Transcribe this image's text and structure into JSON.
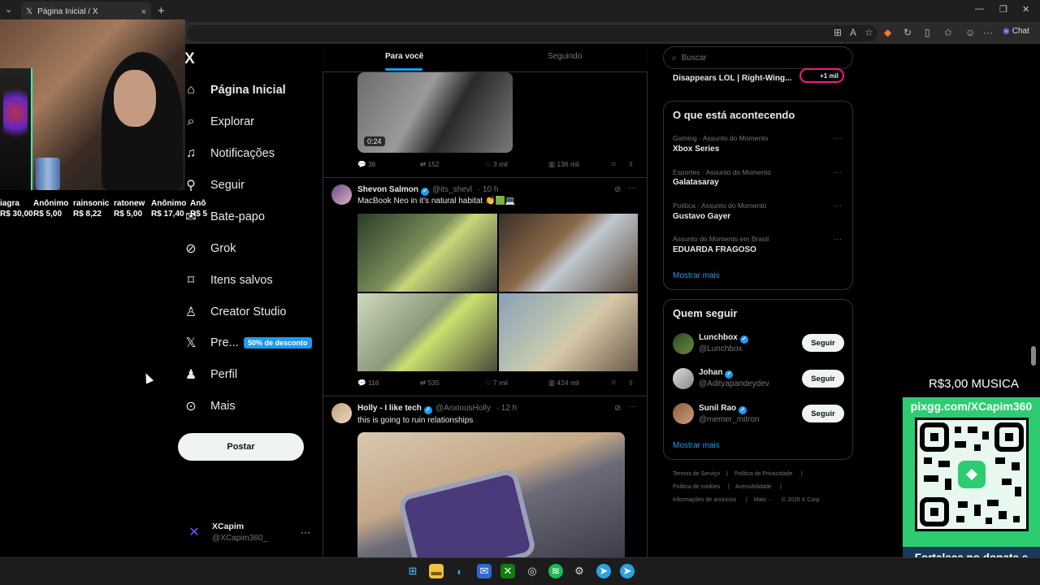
{
  "browser": {
    "tab_title": "Página Inicial / X",
    "tab_close": "×",
    "new_tab": "+",
    "chat_label": "Chat"
  },
  "stream": {
    "donors": [
      {
        "name": "iagra",
        "amount": "R$ 30,00"
      },
      {
        "name": "Anônimo",
        "amount": "R$ 5,00"
      },
      {
        "name": "rainsonic",
        "amount": "R$ 8,22"
      },
      {
        "name": "ratonew",
        "amount": "R$ 5,00"
      },
      {
        "name": "Anônimo",
        "amount": "R$ 17,40"
      },
      {
        "name": "Anô",
        "amount": "R$ 5"
      }
    ],
    "music_price": "R$3,00 MUSICA",
    "qr_url": "pixgg.com/XCapim360",
    "qr_message": "Fortaleça no donate e envie sua mensagem!"
  },
  "sidebar": {
    "logo": "X",
    "items": [
      {
        "label": "Página Inicial",
        "icon": "home-icon"
      },
      {
        "label": "Explorar",
        "icon": "search-icon"
      },
      {
        "label": "Notificações",
        "icon": "bell-icon"
      },
      {
        "label": "Seguir",
        "icon": "add-user-icon"
      },
      {
        "label": "Bate-papo",
        "icon": "chat-icon"
      },
      {
        "label": "Grok",
        "icon": "grok-icon"
      },
      {
        "label": "Itens salvos",
        "icon": "bookmark-icon"
      },
      {
        "label": "Creator Studio",
        "icon": "creator-icon"
      },
      {
        "label": "Pre...",
        "icon": "x-premium-icon"
      },
      {
        "label": "Perfil",
        "icon": "person-icon"
      },
      {
        "label": "Mais",
        "icon": "more-circle-icon"
      }
    ],
    "premium_badge": "50% de desconto",
    "post_button": "Postar",
    "account": {
      "name": "XCapim",
      "handle": "@XCapim360_",
      "more": "···"
    }
  },
  "feed": {
    "tabs": [
      "Para você",
      "Seguindo"
    ],
    "video_post": {
      "duration": "0:24",
      "replies": "36",
      "reposts": "152",
      "likes": "3 mil",
      "views": "136 mil"
    },
    "post2": {
      "author": "Shevon Salmon",
      "handle": "@its_shevl",
      "time": "· 10 h",
      "text": "MacBook Neo in it's natural habitat 👏🟩💻",
      "replies": "116",
      "reposts": "535",
      "likes": "7 mil",
      "views": "424 mil"
    },
    "post3": {
      "author": "Holly - I like tech",
      "handle": "@AnxiousHolly",
      "time": "· 12 h",
      "text": "this is going to ruin relationships"
    }
  },
  "right": {
    "search_placeholder": "Buscar",
    "top_trend": "Disappears LOL | Right-Wing...",
    "live_pill": "+1 mil",
    "trends_title": "O que está acontecendo",
    "trends": [
      {
        "context": "Gaming · Assunto do Momento",
        "name": "Xbox Series"
      },
      {
        "context": "Esportes · Assunto do Momento",
        "name": "Galatasaray"
      },
      {
        "context": "Política · Assunto do Momento",
        "name": "Gustavo Gayer"
      },
      {
        "context": "Assunto do Momento em Brasil",
        "name": "EDUARDA FRAGOSO"
      }
    ],
    "show_more": "Mostrar mais",
    "follow_title": "Quem seguir",
    "follow": [
      {
        "name": "Lunchbox",
        "handle": "@Lunchbox",
        "button": "Seguir"
      },
      {
        "name": "Johan",
        "handle": "@Adityapandeydev",
        "button": "Seguir"
      },
      {
        "name": "Sunil Rao",
        "handle": "@memer_mitron",
        "button": "Seguir"
      }
    ],
    "footer": [
      "Termos de Serviço",
      "|",
      "Política de Privacidade",
      "|",
      "Política de cookies",
      "|",
      "Acessibilidade",
      "|",
      "Informações de anúncios",
      "|",
      "Mais ···",
      "© 2026 X Corp."
    ]
  },
  "colors": {
    "accent": "#1d9bf0",
    "qr_green": "#2ecc71",
    "live": "#f91880"
  }
}
